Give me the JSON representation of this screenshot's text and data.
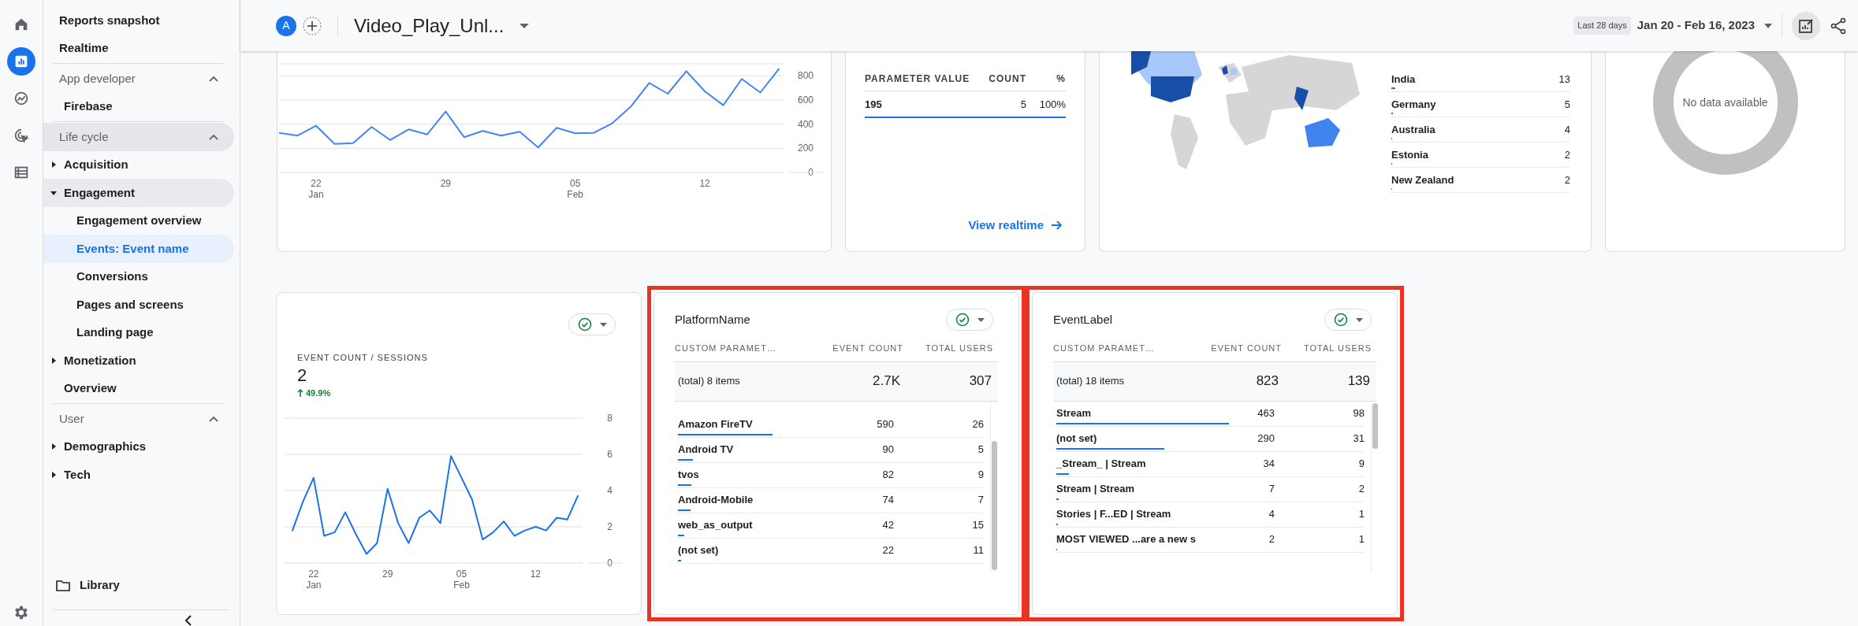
{
  "rail": [
    {
      "kind": "home",
      "selected": false
    },
    {
      "kind": "reports",
      "selected": true
    },
    {
      "kind": "explore",
      "selected": false
    },
    {
      "kind": "advertising",
      "selected": false
    },
    {
      "kind": "configure",
      "selected": false
    }
  ],
  "nav": {
    "links": [
      {
        "label": "Reports snapshot",
        "selected": false
      },
      {
        "label": "Realtime",
        "selected": false
      }
    ],
    "sections": [
      {
        "title": "App developer",
        "expanded": true,
        "highlighted": false,
        "items": [
          {
            "label": "Firebase",
            "selected": false
          }
        ]
      },
      {
        "title": "Life cycle",
        "expanded": true,
        "highlighted": true,
        "items": [
          {
            "label": "Acquisition",
            "expanded": false,
            "selected": false
          },
          {
            "label": "Engagement",
            "expanded": true,
            "selected": false,
            "children": [
              {
                "label": "Engagement overview",
                "selected": false
              },
              {
                "label": "Events: Event name",
                "selected": true
              },
              {
                "label": "Conversions",
                "selected": false
              },
              {
                "label": "Pages and screens",
                "selected": false
              },
              {
                "label": "Landing page",
                "selected": false
              }
            ]
          },
          {
            "label": "Monetization",
            "expanded": false,
            "selected": false
          },
          {
            "label": "Overview",
            "selected": false
          }
        ]
      },
      {
        "title": "User",
        "expanded": true,
        "highlighted": false,
        "items": [
          {
            "label": "Demographics",
            "expanded": false,
            "selected": false
          },
          {
            "label": "Tech",
            "expanded": false,
            "selected": false
          }
        ]
      }
    ],
    "library": "Library"
  },
  "header": {
    "avatar": "A",
    "title": "Video_Play_Unl...",
    "date_badge": "Last 28 days",
    "date_range": "Jan 20 - Feb 16, 2023"
  },
  "trend_card": {
    "chart_data": {
      "type": "line",
      "ylim": [
        0,
        900
      ],
      "values": [
        328,
        305,
        387,
        236,
        243,
        377,
        269,
        357,
        315,
        505,
        292,
        344,
        305,
        338,
        207,
        370,
        325,
        328,
        407,
        544,
        741,
        652,
        839,
        672,
        557,
        774,
        662,
        856
      ],
      "yticks": [
        0,
        200,
        400,
        600,
        800
      ],
      "grid": true,
      "categories": [
        null,
        null,
        "22 Jan",
        null,
        null,
        null,
        null,
        null,
        null,
        "29",
        null,
        null,
        null,
        null,
        null,
        null,
        "05 Feb",
        null,
        null,
        null,
        null,
        null,
        null,
        "12",
        null,
        null,
        null,
        null
      ]
    }
  },
  "realtime_card": {
    "columns": [
      "PARAMETER VALUE",
      "COUNT",
      "%"
    ],
    "rows": [
      {
        "cells": [
          "195",
          "5",
          "100%"
        ],
        "level": 1
      }
    ],
    "link": "View realtime"
  },
  "country_card": {
    "rows": [
      {
        "name": "India",
        "value": "13",
        "level": 0.02
      },
      {
        "name": "Germany",
        "value": "5",
        "level": 0.008
      },
      {
        "name": "Australia",
        "value": "4",
        "level": 0.006
      },
      {
        "name": "Estonia",
        "value": "2",
        "level": 0.003
      },
      {
        "name": "New Zealand",
        "value": "2",
        "level": 0.003
      }
    ]
  },
  "donut_card": {
    "message": "No data available"
  },
  "bottom_cards": [
    {
      "kind": "metric",
      "highlighted": false,
      "metric_label": "EVENT COUNT / SESSIONS",
      "metric_value": "2",
      "change": "49.9%",
      "chart_data": {
        "type": "line",
        "values": [
          1.8,
          3.4,
          4.7,
          1.5,
          1.7,
          2.8,
          1.6,
          0.5,
          1.1,
          4.1,
          2.2,
          1.1,
          2.5,
          2.9,
          2.2,
          5.9,
          4.7,
          3.5,
          1.3,
          1.7,
          2.3,
          1.5,
          1.8,
          2.0,
          1.8,
          2.5,
          2.4,
          3.7
        ],
        "ylim": [
          0,
          8
        ],
        "yticks": [
          0,
          2,
          4,
          6,
          8
        ],
        "grid": true,
        "categories": [
          null,
          null,
          "22 Jan",
          null,
          null,
          null,
          null,
          null,
          null,
          "29",
          null,
          null,
          null,
          null,
          null,
          null,
          "05 Feb",
          null,
          null,
          null,
          null,
          null,
          null,
          "12",
          null,
          null,
          null,
          null
        ]
      }
    },
    {
      "kind": "table",
      "highlighted": true,
      "title": "PlatformName",
      "columns": [
        "CUSTOM PARAMET…",
        "EVENT COUNT",
        "TOTAL USERS"
      ],
      "total": [
        "(total) 8 items",
        "2.7K",
        "307"
      ],
      "scrolled": true,
      "rows": [
        {
          "cells": [
            "Amazon FireTV",
            "590",
            "26"
          ],
          "level": 0.31
        },
        {
          "cells": [
            "Android TV",
            "90",
            "5"
          ],
          "level": 0.05
        },
        {
          "cells": [
            "tvos",
            "82",
            "9"
          ],
          "level": 0.045
        },
        {
          "cells": [
            "Android-Mobile",
            "74",
            "7"
          ],
          "level": 0.04
        },
        {
          "cells": [
            "web_as_output",
            "42",
            "15"
          ],
          "level": 0.02
        },
        {
          "cells": [
            "(not set)",
            "22",
            "11"
          ],
          "level": 0.01
        }
      ]
    },
    {
      "kind": "table",
      "highlighted": true,
      "title": "EventLabel",
      "columns": [
        "CUSTOM PARAMET…",
        "EVENT COUNT",
        "TOTAL USERS"
      ],
      "total": [
        "(total) 18 items",
        "823",
        "139"
      ],
      "scrolled": false,
      "rows": [
        {
          "cells": [
            "Stream",
            "463",
            "98"
          ],
          "level": 0.56
        },
        {
          "cells": [
            "(not set)",
            "290",
            "31"
          ],
          "level": 0.35
        },
        {
          "cells": [
            "_Stream_ | Stream",
            "34",
            "9"
          ],
          "level": 0.04
        },
        {
          "cells": [
            "Stream | Stream",
            "7",
            "2"
          ],
          "level": 0.008
        },
        {
          "cells": [
            "Stories | F...ED | Stream",
            "4",
            "1"
          ],
          "level": 0.005
        },
        {
          "cells": [
            "MOST VIEWED ...are a new s",
            "2",
            "1"
          ],
          "level": 0.002
        }
      ]
    }
  ]
}
